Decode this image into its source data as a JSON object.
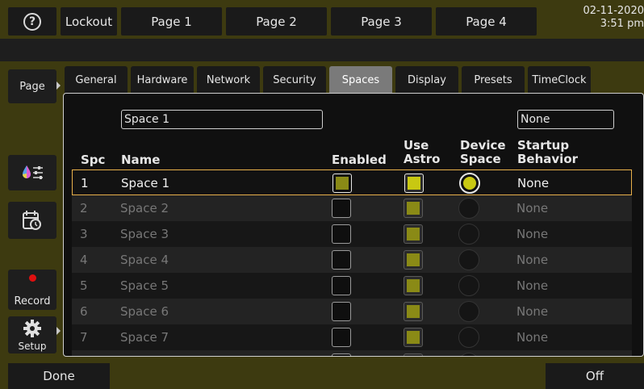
{
  "topbar": {
    "help_glyph": "?",
    "buttons": [
      "Lockout",
      "Page 1",
      "Page 2",
      "Page 3",
      "Page 4"
    ],
    "date": "02-11-2020",
    "time": "3:51 pm"
  },
  "left": {
    "page_label": "Page",
    "record_label": "Record",
    "setup_label": "Setup"
  },
  "tabs": [
    "General",
    "Hardware",
    "Network",
    "Security",
    "Spaces",
    "Display",
    "Presets",
    "TimeClock"
  ],
  "active_tab": "Spaces",
  "editor": {
    "name_value": "Space 1",
    "startup_value": "None"
  },
  "columns": {
    "spc": "Spc",
    "name": "Name",
    "enabled": "Enabled",
    "use_astro_1": "Use",
    "use_astro_2": "Astro",
    "device_space_1": "Device",
    "device_space_2": "Space",
    "startup_1": "Startup",
    "startup_2": "Behavior"
  },
  "rows": [
    {
      "spc": "1",
      "name": "Space 1",
      "startup": "None"
    },
    {
      "spc": "2",
      "name": "Space 2",
      "startup": "None"
    },
    {
      "spc": "3",
      "name": "Space 3",
      "startup": "None"
    },
    {
      "spc": "4",
      "name": "Space 4",
      "startup": "None"
    },
    {
      "spc": "5",
      "name": "Space 5",
      "startup": "None"
    },
    {
      "spc": "6",
      "name": "Space 6",
      "startup": "None"
    },
    {
      "spc": "7",
      "name": "Space 7",
      "startup": "None"
    }
  ],
  "bottom": {
    "done_label": "Done",
    "off_label": "Off"
  },
  "colors": {
    "background": "#3d3a10",
    "accent": "#c8c812",
    "selection": "#e8b04a",
    "record_dot": "#e01010"
  }
}
